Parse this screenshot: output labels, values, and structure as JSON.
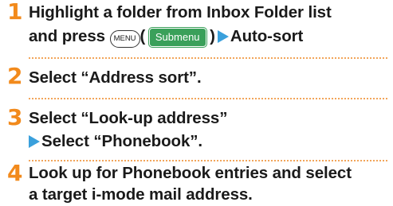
{
  "steps": [
    {
      "number": "1",
      "line1": "Highlight a folder from Inbox Folder list",
      "line2_pre": "and press",
      "menu_key": "MENU",
      "paren_open": "(",
      "softkey_label": "Submenu",
      "paren_close": ")",
      "line2_post": "Auto-sort"
    },
    {
      "number": "2",
      "line1": "Select “Address sort”."
    },
    {
      "number": "3",
      "line1": "Select “Look-up address”",
      "line2": "Select “Phonebook”."
    },
    {
      "number": "4",
      "line1": "Look up for Phonebook entries and select",
      "line2": "a target i-mode mail address."
    }
  ],
  "colors": {
    "step_number": "#f28a1c",
    "arrow": "#3aa0dc",
    "softkey_bg": "#3aa05a",
    "separator": "#f2a55a"
  },
  "icons": {
    "arrow": "right-triangle-icon",
    "menu_key": "menu-key-icon"
  }
}
